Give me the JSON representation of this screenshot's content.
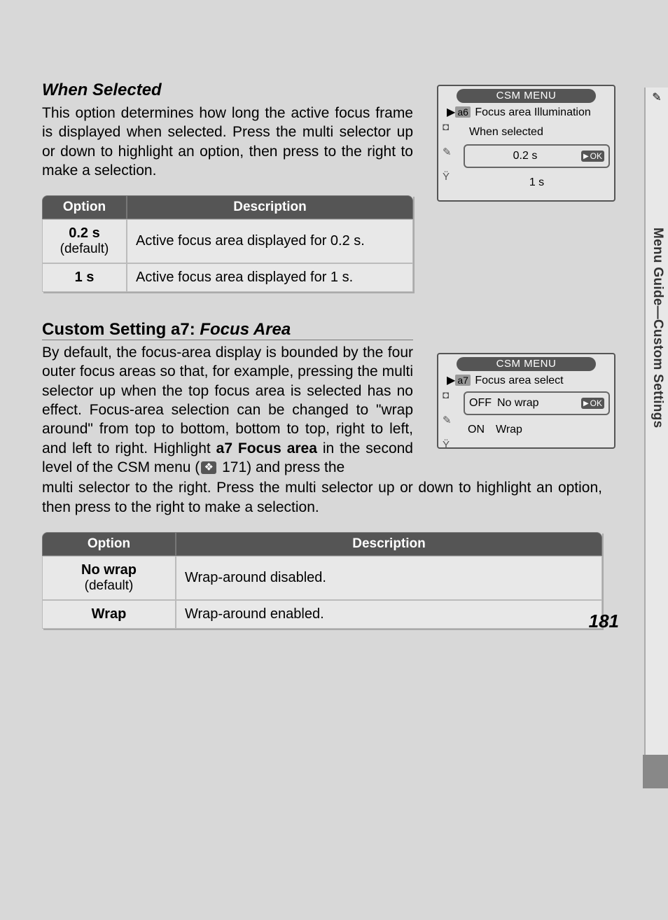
{
  "sideTab": {
    "label": "Menu Guide—Custom Settings"
  },
  "section1": {
    "heading": "When Selected",
    "body": "This option determines how long the active focus frame is displayed when selected.  Press the multi selector up or down to highlight an option, then press to the right to make a selection.",
    "table": {
      "headers": [
        "Option",
        "Description"
      ],
      "rows": [
        {
          "opt": "0.2 s",
          "default": "(default)",
          "desc": "Active focus area displayed for 0.2 s."
        },
        {
          "opt": "1 s",
          "default": "",
          "desc": "Active focus area displayed for 1 s."
        }
      ]
    },
    "lcd": {
      "title": "CSM MENU",
      "badge": "a6",
      "subtitle": "Focus area Illumination",
      "label_row": "When selected",
      "options": [
        {
          "prefix": "",
          "text": "0.2 s",
          "highlight": true,
          "ok": "OK"
        },
        {
          "prefix": "",
          "text": "1 s",
          "highlight": false
        }
      ]
    }
  },
  "section2": {
    "heading_plain": "Custom Setting a7: ",
    "heading_italic": "Focus Area",
    "body_part1": "By default, the focus-area display is bounded by the four outer focus areas so that, for example, pressing the multi selector up when the top focus area is selected has no effect.  Focus-area selection can be changed to \"wrap around\" from top to bottom, bottom to top, right to left, and left to right.  Highlight ",
    "body_bold": "a7 Focus area",
    "body_part2": " in the second level of the CSM menu (",
    "ref_page": "171",
    "body_part3": ") and press the multi selector to the right.  Press the multi selector up or down to highlight an option, then press to the right to make a selection.",
    "table": {
      "headers": [
        "Option",
        "Description"
      ],
      "rows": [
        {
          "opt": "No wrap",
          "default": "(default)",
          "desc": "Wrap-around disabled."
        },
        {
          "opt": "Wrap",
          "default": "",
          "desc": "Wrap-around enabled."
        }
      ]
    },
    "lcd": {
      "title": "CSM MENU",
      "badge": "a7",
      "subtitle": "Focus area select",
      "options": [
        {
          "prefix": "OFF",
          "text": "No wrap",
          "highlight": true,
          "ok": "OK"
        },
        {
          "prefix": "ON",
          "text": "Wrap",
          "highlight": false
        }
      ]
    }
  },
  "pageNumber": "181"
}
